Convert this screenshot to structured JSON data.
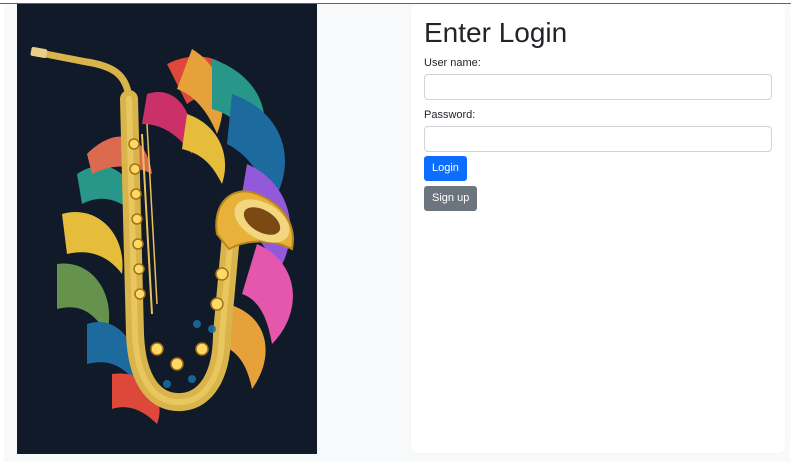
{
  "login": {
    "title": "Enter Login",
    "username_label": "User name:",
    "username_value": "",
    "password_label": "Password:",
    "password_value": "",
    "login_button": "Login",
    "signup_button": "Sign up"
  },
  "hero_image": {
    "description_icon": "saxophone-artwork"
  },
  "colors": {
    "primary_button": "#0d6efd",
    "secondary_button": "#6c757d",
    "page_background": "#f8f9fa",
    "hero_background": "#101a28"
  }
}
